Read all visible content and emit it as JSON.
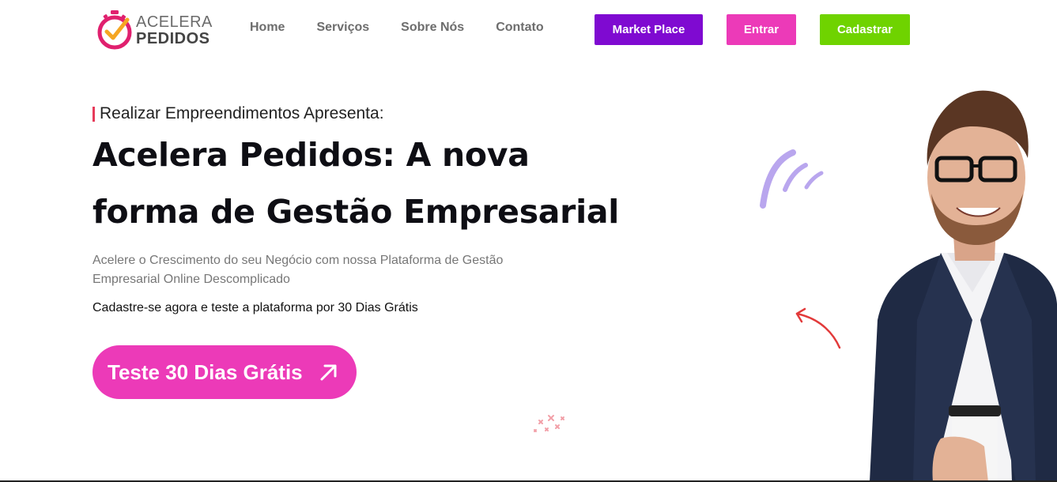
{
  "header": {
    "logo": {
      "line1": "ACELERA",
      "line2": "PEDIDOS"
    },
    "nav": [
      {
        "label": "Home"
      },
      {
        "label": "Serviços"
      },
      {
        "label": "Sobre Nós"
      },
      {
        "label": "Contato"
      }
    ],
    "buttons": {
      "market_place": "Market Place",
      "entrar": "Entrar",
      "cadastrar": "Cadastrar"
    }
  },
  "hero": {
    "pretitle": "Realizar Empreendimentos Apresenta:",
    "title": "Acelera Pedidos: A nova forma de Gestão Empresarial",
    "subtitle": "Acelere o Crescimento do seu Negócio com nossa Plataforma de Gestão Empresarial Online Descomplicado",
    "note": "Cadastre-se agora e teste a plataforma por 30 Dias Grátis",
    "cta": "Teste 30 Dias Grátis"
  },
  "colors": {
    "market_place": "#7f0ad1",
    "entrar": "#ec3ab8",
    "cadastrar": "#6fd300",
    "cta": "#ec3ab8",
    "accent_bar": "#e63b5a"
  },
  "icons": {
    "logo": "stopwatch-check-icon",
    "cta": "arrow-up-right-icon",
    "strokes": "motion-strokes-icon",
    "curved_arrow": "curved-arrow-icon",
    "sparkles": "sparkles-icon"
  }
}
